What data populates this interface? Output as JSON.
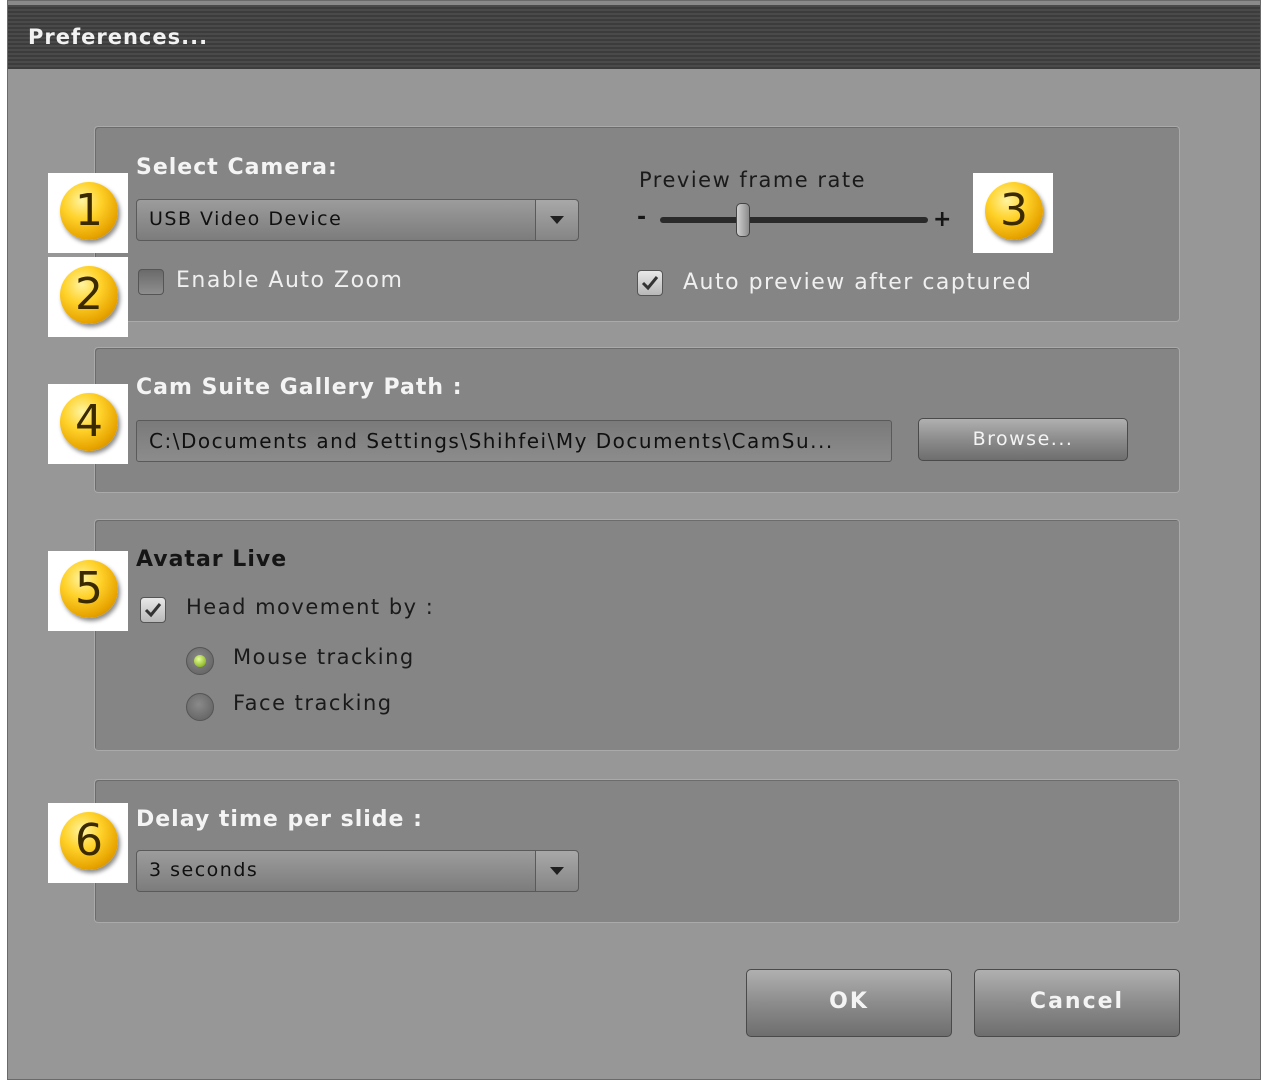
{
  "window": {
    "title": "Preferences..."
  },
  "camera": {
    "label": "Select Camera:",
    "selected": "USB Video Device",
    "auto_zoom_label": "Enable Auto Zoom",
    "auto_zoom_checked": false
  },
  "preview": {
    "label": "Preview frame rate",
    "minus": "-",
    "plus": "+",
    "slider_fraction": 0.3,
    "auto_preview_label": "Auto preview after captured",
    "auto_preview_checked": true
  },
  "gallery": {
    "label": "Cam Suite Gallery Path :",
    "path": "C:\\Documents and Settings\\Shihfei\\My Documents\\CamSu...",
    "browse_label": "Browse..."
  },
  "avatar": {
    "label": "Avatar Live",
    "head_movement_label": "Head movement by :",
    "head_movement_checked": true,
    "options": [
      {
        "label": "Mouse tracking",
        "selected": true
      },
      {
        "label": "Face tracking",
        "selected": false
      }
    ]
  },
  "slideshow": {
    "label": "Delay time per slide :",
    "selected": "3 seconds"
  },
  "buttons": {
    "ok": "OK",
    "cancel": "Cancel"
  },
  "badges": [
    "1",
    "2",
    "3",
    "4",
    "5",
    "6"
  ],
  "colors": {
    "badge": "#ffd22a",
    "radio_selected": "#8ec400"
  }
}
